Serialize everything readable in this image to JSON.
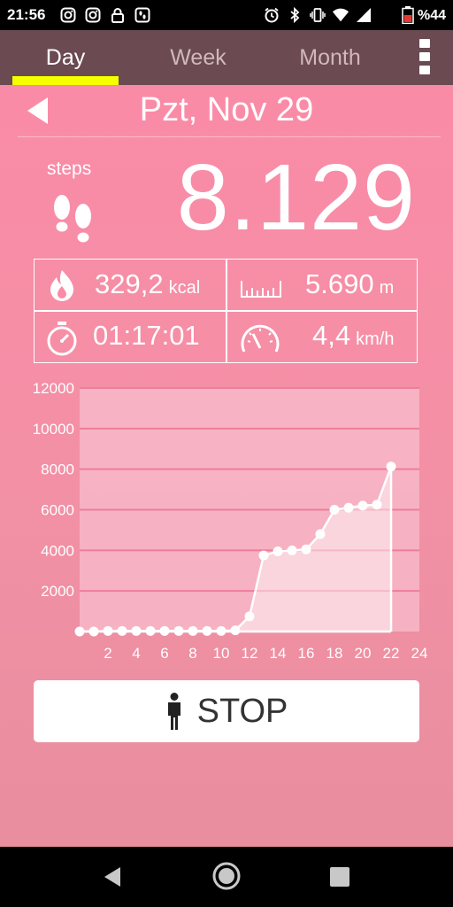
{
  "status_bar": {
    "time": "21:56",
    "battery": "%44",
    "icons_left": [
      "instagram-icon",
      "instagram-icon",
      "lock-icon",
      "fitness-app-icon"
    ],
    "icons_right": [
      "alarm-icon",
      "bluetooth-icon",
      "vibrate-icon",
      "wifi-icon",
      "signal-icon",
      "battery-icon"
    ]
  },
  "tabs": [
    {
      "label": "Day",
      "active": true
    },
    {
      "label": "Week",
      "active": false
    },
    {
      "label": "Month",
      "active": false
    }
  ],
  "date": "Pzt, Nov 29",
  "steps": {
    "label": "steps",
    "value": "8.129"
  },
  "stats": {
    "calories": {
      "value": "329,2",
      "unit": "kcal",
      "icon": "flame-icon"
    },
    "distance": {
      "value": "5.690",
      "unit": "m",
      "icon": "ruler-icon"
    },
    "duration": {
      "value": "01:17:01",
      "icon": "stopwatch-icon"
    },
    "speed": {
      "value": "4,4",
      "unit": "km/h",
      "icon": "speedometer-icon"
    }
  },
  "chart_data": {
    "type": "area",
    "x_ticks": [
      "2",
      "4",
      "6",
      "8",
      "10",
      "12",
      "14",
      "16",
      "18",
      "20",
      "22",
      "24"
    ],
    "y_ticks": [
      "2000",
      "4000",
      "6000",
      "8000",
      "10000",
      "12000"
    ],
    "xlim": [
      0,
      24
    ],
    "ylim": [
      0,
      12000
    ],
    "grid": true,
    "series": [
      {
        "x": [
          0,
          1,
          2,
          3,
          4,
          5,
          6,
          7,
          8,
          9,
          10,
          11,
          12,
          13,
          14,
          15,
          16,
          17,
          18,
          19,
          20,
          21,
          22
        ],
        "values": [
          0,
          0,
          30,
          30,
          30,
          30,
          30,
          30,
          30,
          30,
          30,
          60,
          750,
          3750,
          3950,
          4000,
          4050,
          4800,
          6000,
          6100,
          6200,
          6250,
          8129
        ]
      }
    ],
    "colors": {
      "line": "#ffffff",
      "fill": "#ffffff",
      "grid": "#ef7d99",
      "plot_bg": "#f7b9c8",
      "labels": "#ffffff"
    }
  },
  "stop_button": {
    "label": "STOP",
    "icon": "person-icon"
  },
  "colors": {
    "accent": "#f5ff00",
    "tabbar": "#6b4a52",
    "background": "#fb8aa7"
  }
}
